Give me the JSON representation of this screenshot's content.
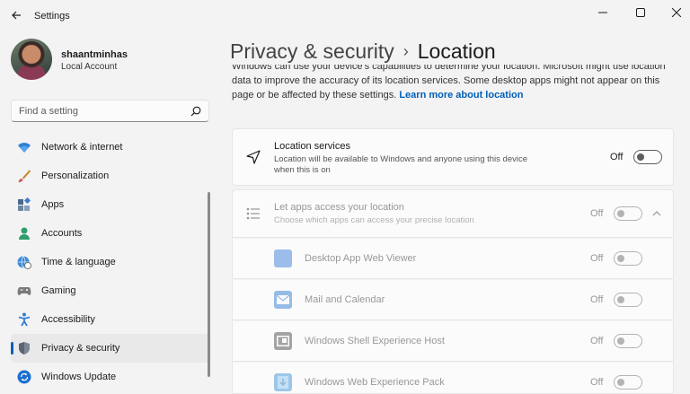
{
  "window": {
    "title": "Settings"
  },
  "profile": {
    "name": "shaantminhas",
    "account_type": "Local Account"
  },
  "search": {
    "placeholder": "Find a setting"
  },
  "sidebar": {
    "items": [
      {
        "label": "Network & internet",
        "icon": "wifi-icon",
        "active": false
      },
      {
        "label": "Personalization",
        "icon": "brush-icon",
        "active": false
      },
      {
        "label": "Apps",
        "icon": "apps-icon",
        "active": false
      },
      {
        "label": "Accounts",
        "icon": "person-icon",
        "active": false
      },
      {
        "label": "Time & language",
        "icon": "globe-clock-icon",
        "active": false
      },
      {
        "label": "Gaming",
        "icon": "gamepad-icon",
        "active": false
      },
      {
        "label": "Accessibility",
        "icon": "accessibility-icon",
        "active": false
      },
      {
        "label": "Privacy & security",
        "icon": "shield-icon",
        "active": true
      },
      {
        "label": "Windows Update",
        "icon": "update-icon",
        "active": false
      }
    ]
  },
  "main": {
    "breadcrumb_parent": "Privacy & security",
    "breadcrumb_separator": "›",
    "breadcrumb_current": "Location",
    "description_top": "Windows can use your device's capabilities to determine your location. Microsoft might use location",
    "description_mid": "data to improve the accuracy of its location services. Some desktop apps might not appear on this",
    "description_end": "page or be affected by these settings.",
    "learn_more": "Learn more about location",
    "location_services": {
      "title": "Location services",
      "subtitle": "Location will be available to Windows and anyone using this device when this is on",
      "state": "Off"
    },
    "apps_access": {
      "title": "Let apps access your location",
      "subtitle": "Choose which apps can access your precise location",
      "state": "Off"
    },
    "apps": [
      {
        "name": "Desktop App Web Viewer",
        "state": "Off",
        "icon": "web-viewer-icon",
        "color": "#2b72d6"
      },
      {
        "name": "Mail and Calendar",
        "state": "Off",
        "icon": "mail-icon",
        "color": "#1e6fd0"
      },
      {
        "name": "Windows Shell Experience Host",
        "state": "Off",
        "icon": "shell-host-icon",
        "color": "#3a3a3a"
      },
      {
        "name": "Windows Web Experience Pack",
        "state": "Off",
        "icon": "web-pack-icon",
        "color": "#2a8ad4"
      }
    ]
  },
  "colors": {
    "accent": "#005fb8",
    "background": "#f3f3f3",
    "card": "#fbfbfb"
  }
}
